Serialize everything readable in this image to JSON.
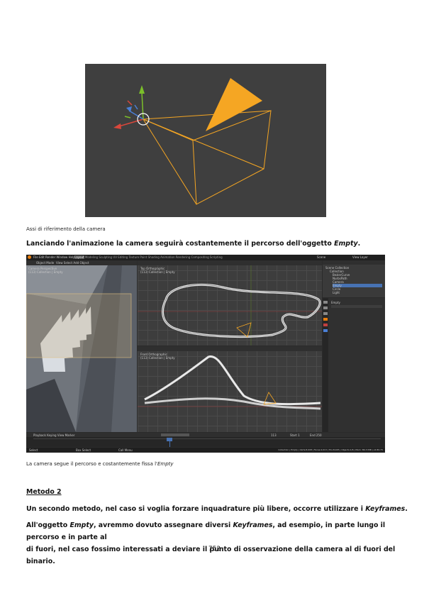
{
  "figure1": {
    "caption": "Assi di riferimento della camera"
  },
  "paragraph1": {
    "text": "Lanciando l'animazione la camera seguirà costantemente il percorso dell'oggetto ",
    "emph": "Empty",
    "tail": "."
  },
  "figure2": {
    "caption_prefix": "La camera segue il percorso e costantemente fissa l'",
    "caption_emph": "Empty",
    "ui": {
      "menu": [
        "File",
        "Edit",
        "Render",
        "Window",
        "Help"
      ],
      "workspaces": [
        "Layout",
        "Modeling",
        "Sculpting",
        "UV Editing",
        "Texture Paint",
        "Shading",
        "Animation",
        "Rendering",
        "Compositing",
        "Scripting"
      ],
      "scene": "Scene",
      "view_layer": "View Layer",
      "mode": "Object Mode",
      "view_menu": [
        "View",
        "Select",
        "Add",
        "Object"
      ],
      "camera_view_label": "Camera Perspective",
      "camera_view_sub": "(113) Collection | Empty",
      "top_view_label": "Top Orthographic",
      "top_view_sub": "(113) Collection | Empty",
      "front_view_label": "Front Orthographic",
      "front_view_sub": "(113) Collection | Empty",
      "outliner_title": "Scene Collection",
      "outliner_items": [
        "Collection",
        "BezierCurve",
        "NurbsPath",
        "Camera",
        "Empty",
        "Circle",
        "Light"
      ],
      "properties_object": "Empty",
      "timeline_menu": [
        "Playback",
        "Keying",
        "View",
        "Marker"
      ],
      "current_frame": "113",
      "start_label": "Start",
      "start_value": "1",
      "end_label": "End",
      "end_value": "250",
      "status_left": "Select",
      "status_mid": "Box Select",
      "status_right": "Call Menu",
      "status_info": "Collection | Empty | Verts:8,008 | Faces:4,013 | Tris:8,025 | Objects:1/6 | Mem: 86.3 MiB | v2.80.75"
    }
  },
  "section": {
    "heading": "Metodo 2",
    "p1_text": "Un secondo metodo, nel caso si voglia forzare inquadrature più libere, occorre utilizzare i ",
    "p1_emph": "Keyframes",
    "p1_tail": ".",
    "p2_a": "All'oggetto ",
    "p2_emph1": "Empty",
    "p2_b": ", avremmo dovuto assegnare diversi ",
    "p2_emph2": "Keyframes",
    "p2_c": ", ad esempio, in parte lungo il percorso e in parte al",
    "p2_line2": "di fuori, nel caso fossimo interessati a deviare il punto di osservazione della camera al di fuori del binario."
  },
  "page_number": "752",
  "colors": {
    "camera_orange": "#f5a623",
    "axis_green": "#7bbf2a",
    "axis_red": "#d9473b",
    "axis_blue": "#4a7fd6",
    "viewport_bg": "#3f3f3f"
  }
}
